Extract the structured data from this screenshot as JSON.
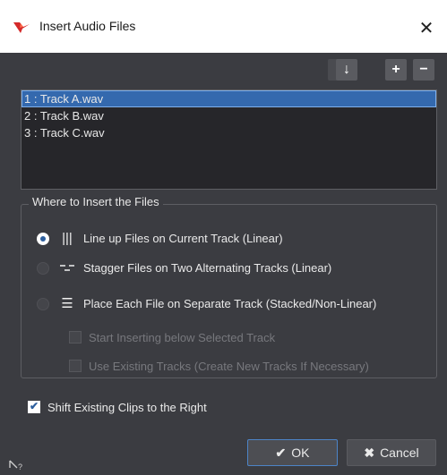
{
  "window": {
    "title": "Insert Audio Files",
    "close_glyph": "✕"
  },
  "toolbar": {
    "move_up_icon": "↑",
    "move_down_icon": "↓",
    "add_icon": "+",
    "remove_icon": "−"
  },
  "files": [
    {
      "label": "1 : Track A.wav",
      "selected": true
    },
    {
      "label": "2 : Track B.wav",
      "selected": false
    },
    {
      "label": "3 : Track C.wav",
      "selected": false
    }
  ],
  "insert_group": {
    "title": "Where to Insert the Files",
    "options": [
      {
        "icon": "|||",
        "label": "Line up Files on Current Track (Linear)",
        "checked": true
      },
      {
        "icon": "-̲-",
        "label": "Stagger Files on Two Alternating Tracks (Linear)",
        "checked": false
      },
      {
        "icon": "☰",
        "label": "Place Each File on Separate Track (Stacked/Non-Linear)",
        "checked": false
      }
    ],
    "sub_options": [
      {
        "label": "Start Inserting below Selected Track",
        "checked": false,
        "enabled": false
      },
      {
        "label": "Use Existing Tracks (Create New Tracks If Necessary)",
        "checked": false,
        "enabled": false
      }
    ]
  },
  "shift_clips": {
    "label": "Shift Existing Clips to the Right",
    "checked": true
  },
  "buttons": {
    "ok_icon": "✔",
    "ok_label": "OK",
    "cancel_icon": "✖",
    "cancel_label": "Cancel"
  },
  "colors": {
    "background": "#3b3c41",
    "selection": "#3469ae",
    "accent": "#2d5f9e",
    "logo_red": "#d42a2a"
  }
}
